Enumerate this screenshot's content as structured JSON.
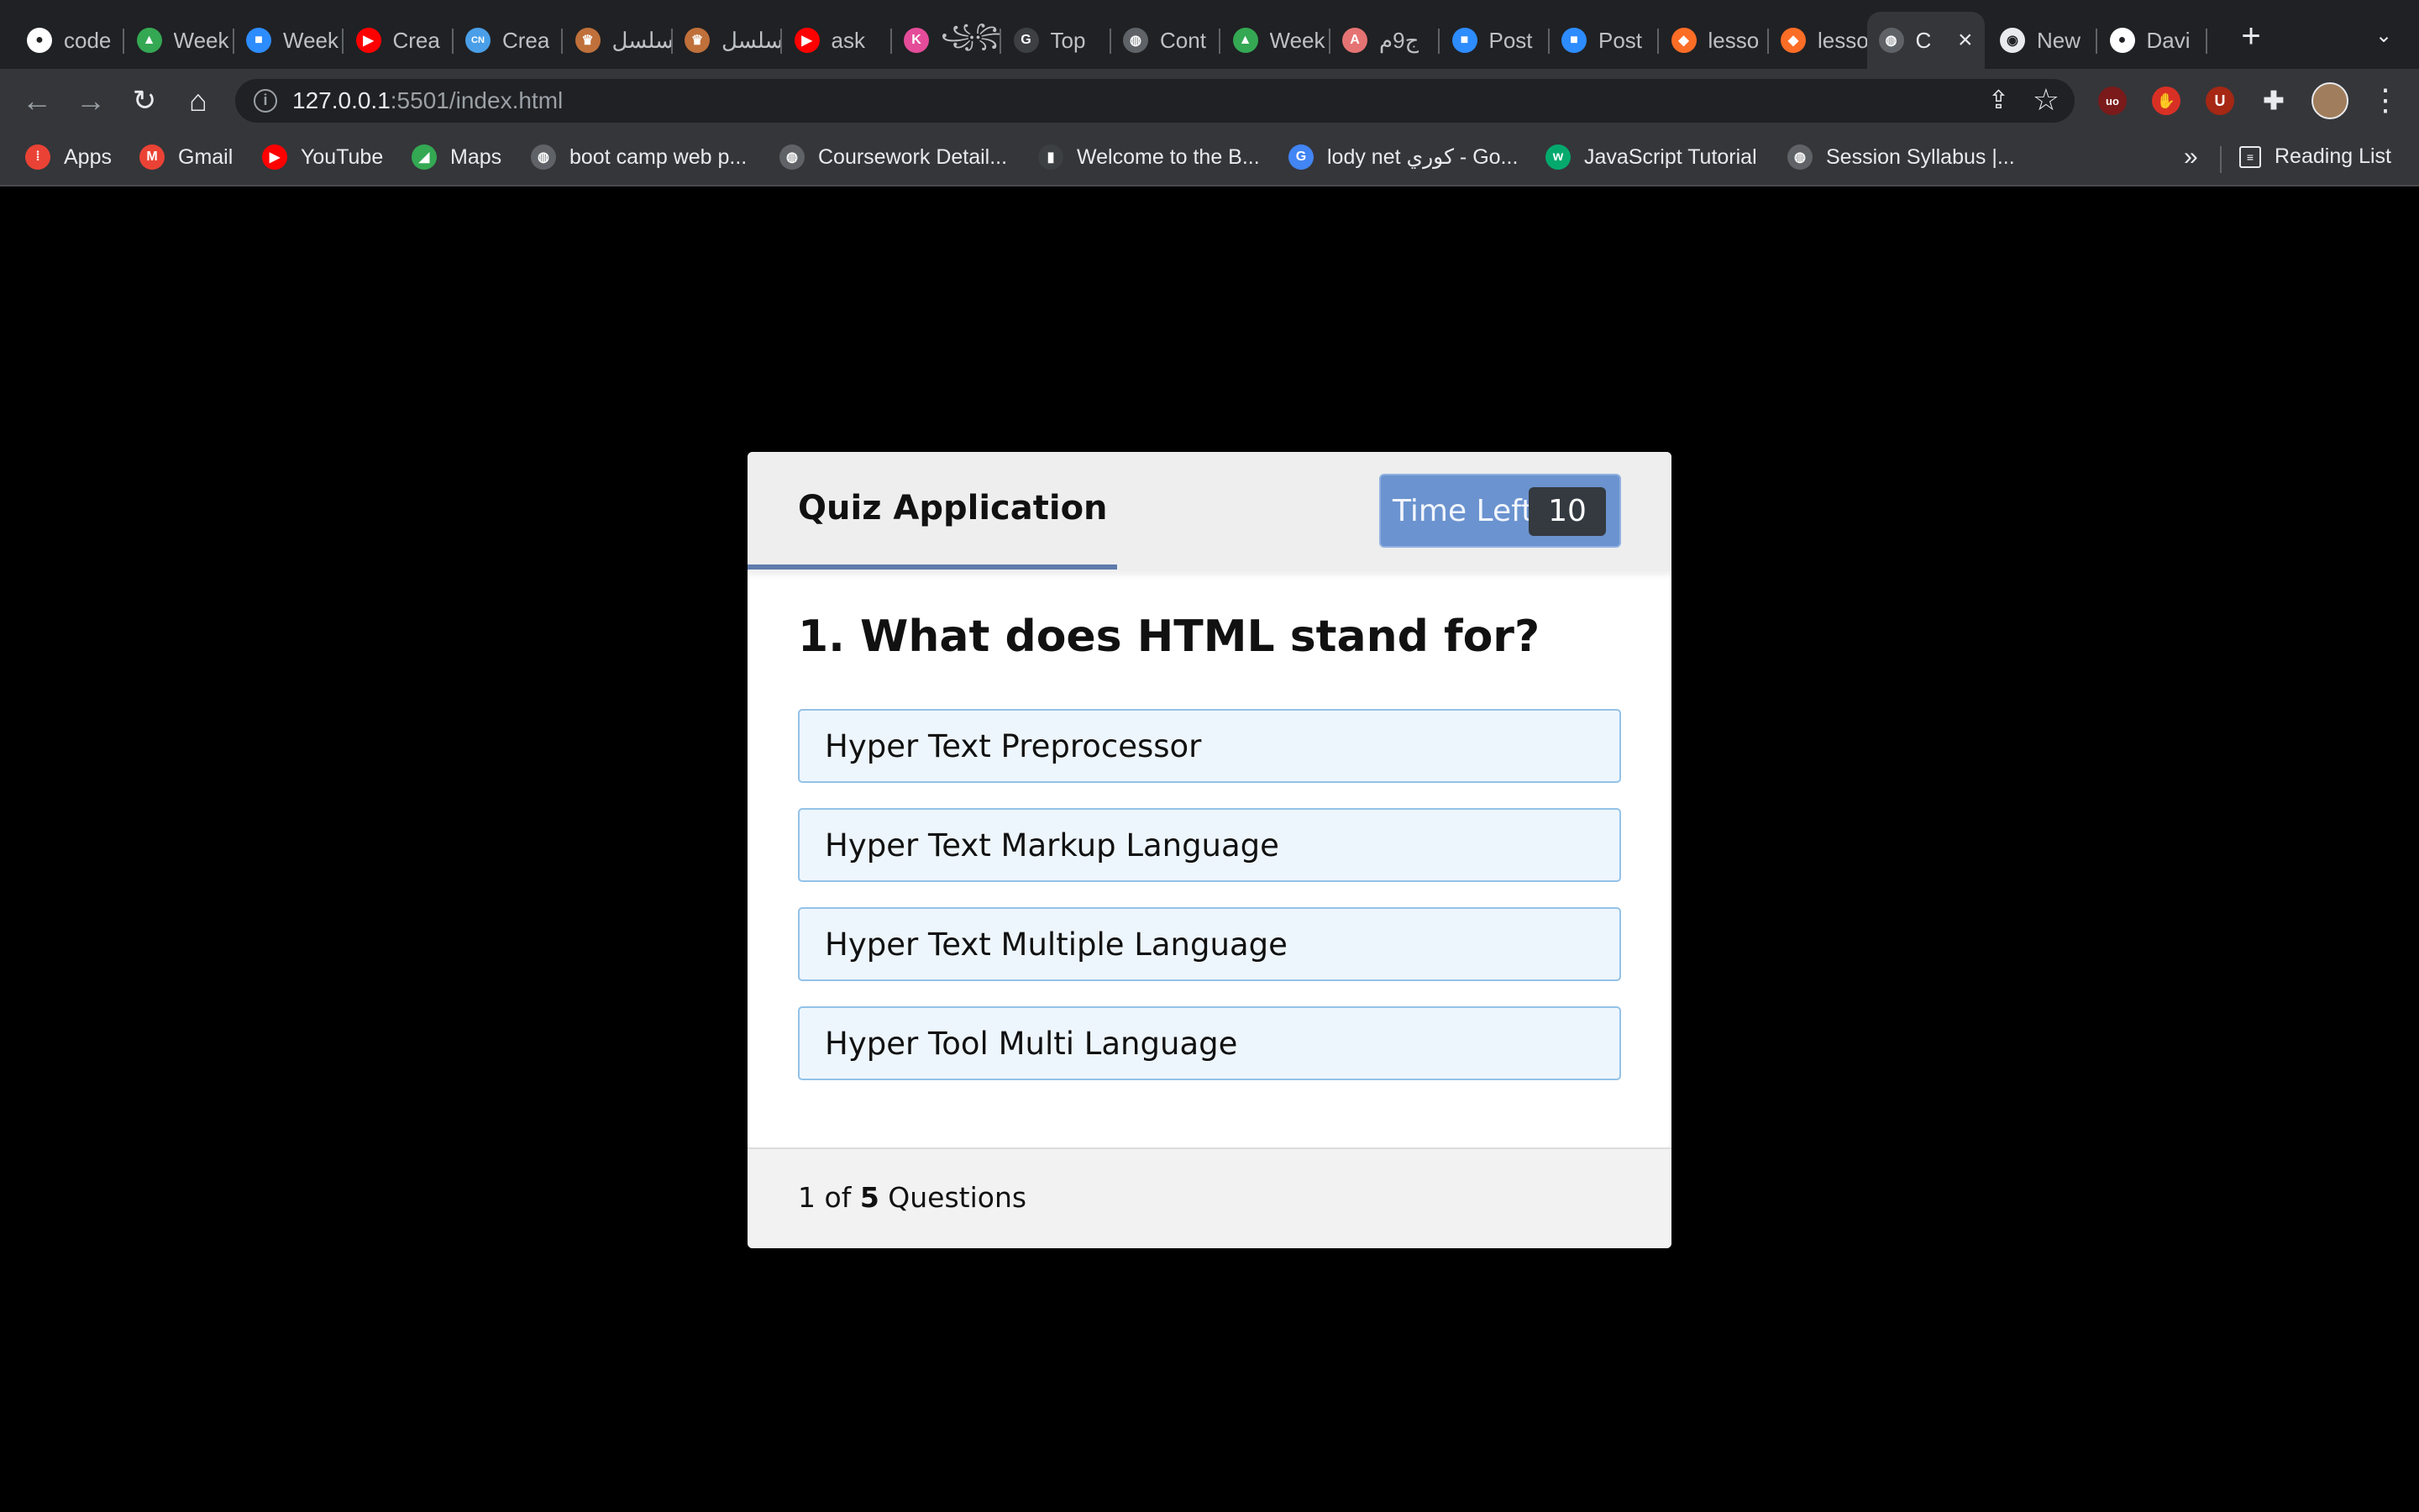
{
  "browser": {
    "tabs": [
      {
        "label": "code",
        "icon": "github-icon",
        "color": "#ffffff"
      },
      {
        "label": "Week",
        "icon": "google-drive-icon",
        "color": "#34a853"
      },
      {
        "label": "Week",
        "icon": "zoom-icon",
        "color": "#2d8cff"
      },
      {
        "label": "Crea",
        "icon": "youtube-icon",
        "color": "#ff0000"
      },
      {
        "label": "Crea",
        "icon": "codenewbie-icon",
        "color": "#4a9fe8"
      },
      {
        "label": "مسلسل",
        "icon": "show-icon",
        "color": "#c0703a"
      },
      {
        "label": "مسلسل",
        "icon": "show-icon",
        "color": "#c0703a"
      },
      {
        "label": "ask",
        "icon": "youtube-icon",
        "color": "#ff0000"
      },
      {
        "label": "꧁꧂",
        "icon": "kotlin-icon",
        "color": "#e44c9a"
      },
      {
        "label": "Top",
        "icon": "site-icon",
        "color": "#3c4043"
      },
      {
        "label": "Cont",
        "icon": "globe-icon",
        "color": "#5f6368"
      },
      {
        "label": "Week",
        "icon": "google-drive-icon",
        "color": "#34a853"
      },
      {
        "label": "ج9م",
        "icon": "angular-icon",
        "color": "#e57373"
      },
      {
        "label": "Post",
        "icon": "zoom-icon",
        "color": "#2d8cff"
      },
      {
        "label": "Post",
        "icon": "zoom-icon",
        "color": "#2d8cff"
      },
      {
        "label": "lesso",
        "icon": "gitlab-icon",
        "color": "#fc6d26"
      },
      {
        "label": "lesso",
        "icon": "gitlab-icon",
        "color": "#fc6d26"
      },
      {
        "label": "C",
        "icon": "globe-icon",
        "color": "#5f6368",
        "active": true
      },
      {
        "label": "New",
        "icon": "chrome-icon",
        "color": "#e8eaed"
      },
      {
        "label": "Davi",
        "icon": "github-icon",
        "color": "#ffffff"
      }
    ],
    "url_host": "127.0.0.1",
    "url_rest": ":5501/index.html",
    "bookmarks": [
      {
        "label": "Apps",
        "icon": "apps-grid-icon",
        "color": "#ea4335"
      },
      {
        "label": "Gmail",
        "icon": "gmail-icon",
        "color": "#ea4335"
      },
      {
        "label": "YouTube",
        "icon": "youtube-icon",
        "color": "#ff0000"
      },
      {
        "label": "Maps",
        "icon": "maps-icon",
        "color": "#34a853"
      },
      {
        "label": "boot camp web p...",
        "icon": "globe-icon",
        "color": "#5f6368"
      },
      {
        "label": "Coursework Detail...",
        "icon": "globe-icon",
        "color": "#5f6368"
      },
      {
        "label": "Welcome to the B...",
        "icon": "book-icon",
        "color": "#3c4043"
      },
      {
        "label": "lody net كوري - Go...",
        "icon": "google-icon",
        "color": "#4285f4"
      },
      {
        "label": "JavaScript Tutorial",
        "icon": "w3schools-icon",
        "color": "#04aa6d"
      },
      {
        "label": "Session Syllabus |...",
        "icon": "globe-icon",
        "color": "#5f6368"
      }
    ],
    "more_label": "»",
    "reading_list": "Reading List"
  },
  "quiz": {
    "title": "Quiz Application",
    "timer_label": "Time Left",
    "timer_value": "10",
    "progress_fraction": 0.4,
    "question": "1. What does HTML stand for?",
    "options": [
      "Hyper Text Preprocessor",
      "Hyper Text Markup Language",
      "Hyper Text Multiple Language",
      "Hyper Tool Multi Language"
    ],
    "footer": {
      "current": "1",
      "of": "of",
      "total": "5",
      "suffix": "Questions"
    }
  }
}
